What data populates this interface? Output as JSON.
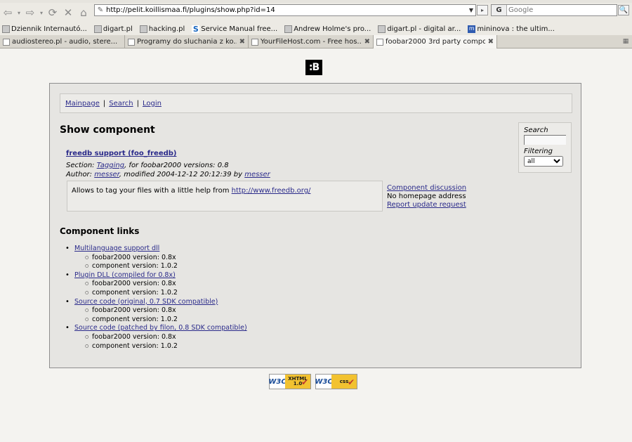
{
  "browser": {
    "url": "http://pelit.koillismaa.fi/plugins/show.php?id=14",
    "search_placeholder": "Google",
    "search_engine_letter": "G",
    "bookmarks": [
      {
        "label": "Dziennik Internautó...",
        "icon": "page-icon"
      },
      {
        "label": "digart.pl",
        "icon": "page-icon"
      },
      {
        "label": "hacking.pl",
        "icon": "page-icon"
      },
      {
        "label": "Service Manual free...",
        "icon": "s-icon"
      },
      {
        "label": "Andrew Holme's pro...",
        "icon": "page-icon"
      },
      {
        "label": "digart.pl - digital ar...",
        "icon": "page-icon"
      },
      {
        "label": "mininova : the ultim...",
        "icon": "m-icon"
      }
    ],
    "tabs": [
      {
        "title": "audiostereo.pl - audio, stere...",
        "active": false
      },
      {
        "title": "Programy do sluchania z ko...",
        "active": false
      },
      {
        "title": "YourFileHost.com - Free hos...",
        "active": false
      },
      {
        "title": "foobar2000 3rd party compo...",
        "active": true
      }
    ]
  },
  "page": {
    "logo_text": ":B",
    "nav": {
      "mainpage": "Mainpage",
      "search": "Search",
      "login": "Login",
      "sep": "|"
    },
    "heading": "Show component",
    "component": {
      "name": "freedb support (foo_freedb)",
      "section_prefix": "Section: ",
      "section": "Tagging",
      "versions_text": ", for foobar2000 versions: 0.8",
      "author_prefix": "Author: ",
      "author": "messer",
      "modified_text": ", modified 2004-12-12 20:12:39 by ",
      "modified_by": "messer",
      "description": "Allows to tag your files with a little help from ",
      "description_link": "http://www.freedb.org/"
    },
    "side_links": {
      "discussion": "Component discussion",
      "homepage": "No homepage address",
      "report": "Report update request"
    },
    "sidebox": {
      "search_label": "Search",
      "filter_label": "Filtering",
      "filter_value": "all"
    },
    "links_heading": "Component links",
    "links": [
      {
        "title": "Multilanguage support dll",
        "fb_version": "foobar2000 version: 0.8x",
        "comp_version": "component version: 1.0.2"
      },
      {
        "title": "Plugin DLL (compiled for 0.8x)",
        "fb_version": "foobar2000 version: 0.8x",
        "comp_version": "component version: 1.0.2"
      },
      {
        "title": "Source code (original, 0.7 SDK compatible)",
        "fb_version": "foobar2000 version: 0.8x",
        "comp_version": "component version: 1.0.2"
      },
      {
        "title": "Source code (patched by filon, 0.8 SDK compatible)",
        "fb_version": "foobar2000 version: 0.8x",
        "comp_version": "component version: 1.0.2"
      }
    ],
    "badges": [
      {
        "w3c": "W3C",
        "kind_top": "XHTML",
        "kind_bottom": "1.0"
      },
      {
        "w3c": "W3C",
        "kind_top": "css",
        "kind_bottom": ""
      }
    ]
  }
}
